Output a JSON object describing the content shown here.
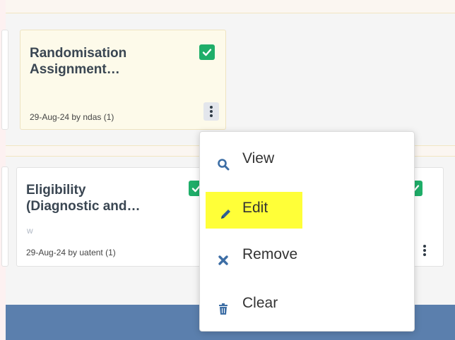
{
  "cards": {
    "randomisation": {
      "title_line1": "Randomisation",
      "title_line2": "Assignment…",
      "meta": "29-Aug-24 by ndas (1)"
    },
    "eligibility": {
      "title_line1": "Eligibility",
      "title_line2": "(Diagnostic and…",
      "sub_icon": "ᴡ",
      "meta": "29-Aug-24 by uatent (1)"
    }
  },
  "context_menu": {
    "items": [
      {
        "label": "View",
        "icon": "search-icon"
      },
      {
        "label": "Edit",
        "icon": "pencil-icon",
        "highlighted": true
      },
      {
        "label": "Remove",
        "icon": "close-icon"
      },
      {
        "label": "Clear",
        "icon": "trash-icon"
      }
    ]
  },
  "colors": {
    "check_green": "#1fae69",
    "highlight_yellow": "#ffff38",
    "icon_blue": "#3d6ea5",
    "footer_blue": "#5b7fad"
  }
}
